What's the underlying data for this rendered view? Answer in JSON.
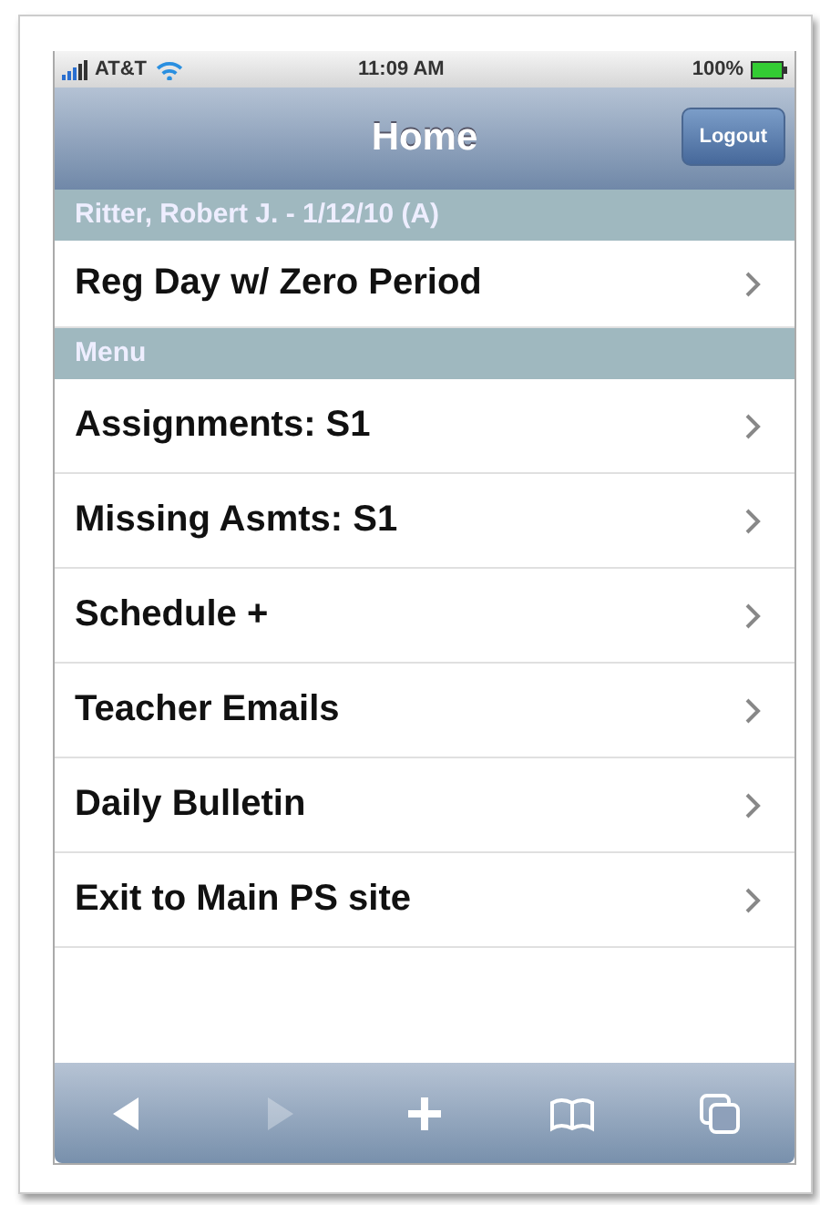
{
  "status_bar": {
    "carrier": "AT&T",
    "time": "11:09 AM",
    "battery": "100%"
  },
  "nav_bar": {
    "title": "Home",
    "button": "Logout"
  },
  "sections": [
    {
      "header": "Ritter, Robert J. - 1/12/10 (A)",
      "items": [
        {
          "label": "Reg Day w/ Zero Period"
        }
      ]
    },
    {
      "header": "Menu",
      "items": [
        {
          "label": "Assignments: S1"
        },
        {
          "label": "Missing Asmts: S1"
        },
        {
          "label": "Schedule +"
        },
        {
          "label": "Teacher Emails"
        },
        {
          "label": "Daily Bulletin"
        },
        {
          "label": "Exit to Main PS site"
        }
      ]
    }
  ],
  "toolbar": [
    {
      "kind": "back",
      "disabled": false
    },
    {
      "kind": "forward",
      "disabled": true
    },
    {
      "kind": "add",
      "disabled": false
    },
    {
      "kind": "bookmarks",
      "disabled": false
    },
    {
      "kind": "pages",
      "disabled": false
    }
  ]
}
